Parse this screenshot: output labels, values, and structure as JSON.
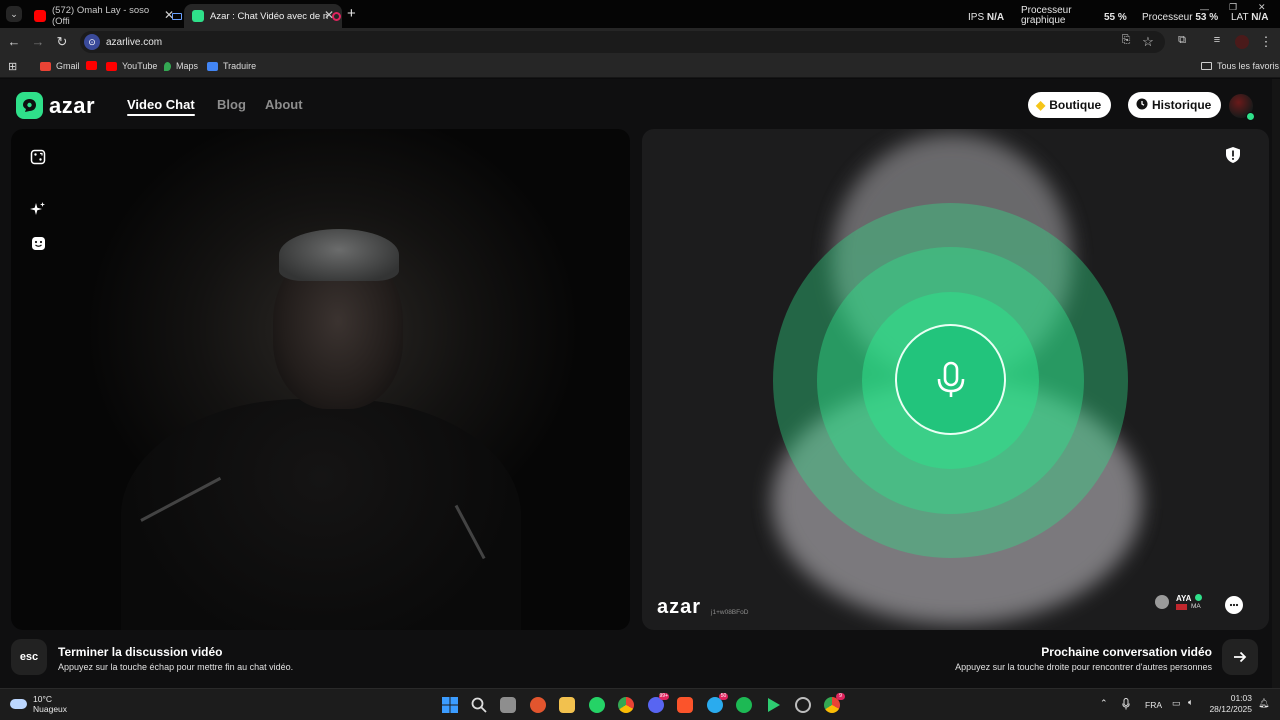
{
  "browser": {
    "tabs": [
      {
        "title": "(572) Omah Lay - soso (Offi",
        "active": false,
        "favicon_color": "#ff0000"
      },
      {
        "title": "Azar : Chat Vidéo avec de n",
        "active": true,
        "favicon_color": "#2fe08a"
      }
    ],
    "new_tab_label": "+",
    "system_stats": {
      "ips_label": "IPS",
      "ips_value": "N/A",
      "gpu_label_1": "Processeur",
      "gpu_label_2": "graphique",
      "gpu_value": "55 %",
      "cpu_label": "Processeur",
      "cpu_value": "53 %",
      "lat_label": "LAT",
      "lat_value": "N/A"
    },
    "url": "azarlive.com",
    "bookmarks": [
      {
        "label": "Gmail",
        "color": "#ea4335"
      },
      {
        "label": "",
        "color": "#ff0000"
      },
      {
        "label": "YouTube",
        "color": "#ff0000"
      },
      {
        "label": "Maps",
        "color": "#34a853"
      },
      {
        "label": "Traduire",
        "color": "#4285f4"
      }
    ],
    "favorites_label": "Tous les favoris"
  },
  "azar": {
    "logo_text": "azar",
    "nav": [
      {
        "label": "Video Chat",
        "active": true
      },
      {
        "label": "Blog",
        "active": false
      },
      {
        "label": "About",
        "active": false
      }
    ],
    "shop_label": "Boutique",
    "history_label": "Historique",
    "side_tools": [
      "random-match-icon",
      "sparkle-effects-icon",
      "face-sticker-icon"
    ],
    "watermark_text": "azar",
    "watermark_code": "j1+w08BFoD",
    "peer": {
      "name": "AYA",
      "country": "MA"
    },
    "accent_color": "#2fe08a"
  },
  "controls": {
    "esc_key": "esc",
    "end_title": "Terminer la discussion vidéo",
    "end_sub": "Appuyez sur la touche échap pour mettre fin au chat vidéo.",
    "next_title": "Prochaine conversation vidéo",
    "next_sub": "Appuyez sur la touche droite pour rencontrer d'autres personnes"
  },
  "taskbar": {
    "weather_temp": "10°C",
    "weather_desc": "Nuageux",
    "apps": [
      {
        "name": "start",
        "color": "#3b9cff",
        "badge": ""
      },
      {
        "name": "search",
        "color": "#cfcfcf",
        "badge": ""
      },
      {
        "name": "task-view",
        "color": "#9a9a9a",
        "badge": ""
      },
      {
        "name": "app-orange",
        "color": "#e2552e",
        "badge": ""
      },
      {
        "name": "file-explorer",
        "color": "#f2c14e",
        "badge": ""
      },
      {
        "name": "whatsapp",
        "color": "#25d366",
        "badge": ""
      },
      {
        "name": "chrome",
        "color": "#4285f4",
        "badge": ""
      },
      {
        "name": "discord",
        "color": "#5865f2",
        "badge": "99+"
      },
      {
        "name": "brave",
        "color": "#fb542b",
        "badge": ""
      },
      {
        "name": "telegram",
        "color": "#2aabee",
        "badge": "50"
      },
      {
        "name": "spotify",
        "color": "#1db954",
        "badge": ""
      },
      {
        "name": "app-green",
        "color": "#2ecc71",
        "badge": ""
      },
      {
        "name": "app-ring",
        "color": "#bdbdbd",
        "badge": ""
      },
      {
        "name": "chrome-profile",
        "color": "#e94235",
        "badge": "9"
      }
    ],
    "language": "FRA",
    "time": "01:03",
    "date": "28/12/2025"
  }
}
